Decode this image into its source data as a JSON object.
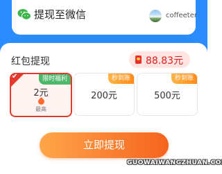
{
  "wechat": {
    "title": "提现至微信",
    "username": "coffeeter"
  },
  "redpacket": {
    "label": "红包提现",
    "balance": "88.83元"
  },
  "options": [
    {
      "tag": "限时福利",
      "amount": "2元",
      "note": "最高",
      "selected": true
    },
    {
      "tag": "秒到账",
      "amount": "200元"
    },
    {
      "tag": "秒到账",
      "amount": "500元"
    }
  ],
  "button": {
    "label": "立即提现"
  },
  "watermark": "GUOWAIWANGZHUAN.COM",
  "colors": {
    "accent_blue": "#2a8cff",
    "accent_red": "#e23a2c",
    "button_orange": "#f5631e",
    "tag_green": "#4bb86b"
  }
}
